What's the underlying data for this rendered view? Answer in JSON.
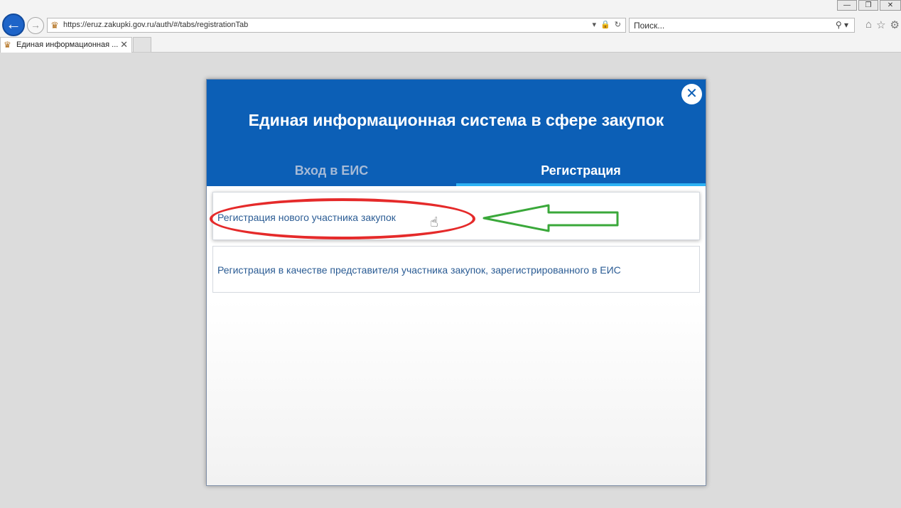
{
  "browser": {
    "url": "https://eruz.zakupki.gov.ru/auth/#/tabs/registrationTab",
    "search_placeholder": "Поиск...",
    "tab_title": "Единая информационная ...",
    "tab_close": "✕",
    "window_controls": {
      "minimize": "—",
      "restore": "❐",
      "close": "✕"
    },
    "icons": [
      "back-icon",
      "forward-icon",
      "home-icon",
      "star-icon",
      "gear-icon"
    ]
  },
  "modal": {
    "title": "Единая информационная система в сфере закупок",
    "close_label": "✕",
    "tabs": [
      {
        "label": "Вход в ЕИС",
        "active": false
      },
      {
        "label": "Регистрация",
        "active": true
      }
    ],
    "options": [
      {
        "label": "Регистрация нового участника закупок"
      },
      {
        "label": "Регистрация в качестве представителя участника закупок, зарегистрированного в ЕИС"
      }
    ]
  },
  "colors": {
    "header_blue": "#0c5fb6",
    "active_tab_underline": "#2db2f4",
    "link_text": "#2b5c94",
    "annotation_red": "#e52a2a",
    "annotation_green": "#3aa83a"
  }
}
